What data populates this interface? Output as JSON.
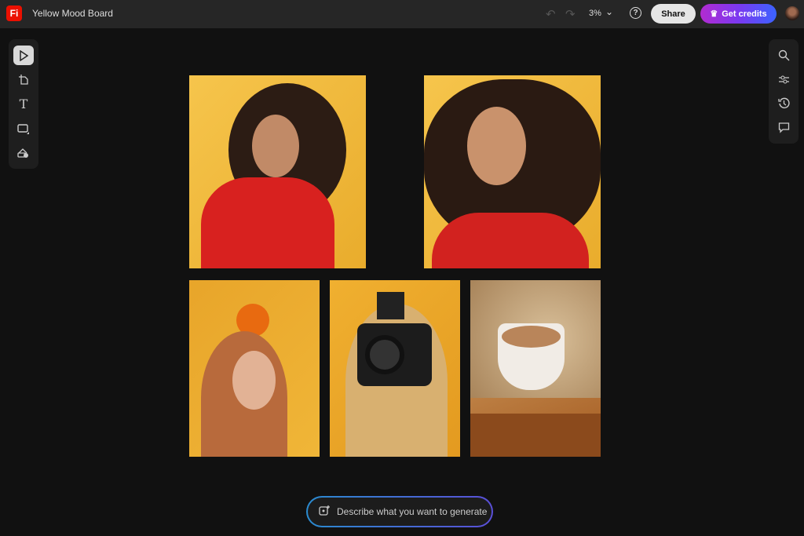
{
  "app": {
    "logo": "Fi",
    "title": "Yellow Mood Board"
  },
  "toolbar": {
    "zoom": "3%",
    "share_label": "Share",
    "credits_label": "Get credits",
    "help": "?"
  },
  "left_tools": [
    "select-icon",
    "crop-icon",
    "text-icon",
    "rectangle-icon",
    "generate-image-icon"
  ],
  "right_tools": [
    "search-icon",
    "adjust-icon",
    "history-icon",
    "comment-icon"
  ],
  "prompt": {
    "placeholder": "Describe what you want to generate"
  },
  "colors": {
    "accent_start": "#b22bd0",
    "accent_end": "#3b63ff",
    "canvas": "#111111",
    "logo": "#eb1000"
  }
}
